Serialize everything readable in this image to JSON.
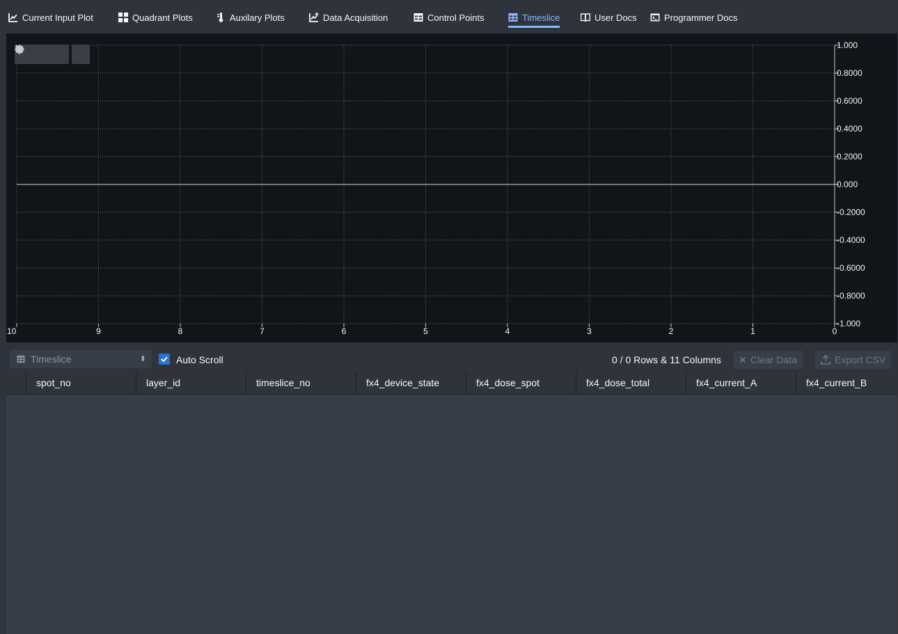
{
  "nav": {
    "tabs": [
      {
        "label": "Current Input Plot",
        "icon": "line-chart-icon"
      },
      {
        "label": "Quadrant Plots",
        "icon": "grid-icon"
      },
      {
        "label": "Auxilary Plots",
        "icon": "thermometer-icon"
      },
      {
        "label": "Data Acquisition",
        "icon": "chart-plus-icon"
      },
      {
        "label": "Control Points",
        "icon": "table-icon"
      },
      {
        "label": "Timeslice",
        "icon": "table-icon",
        "active": true
      },
      {
        "label": "User Docs",
        "icon": "book-icon"
      },
      {
        "label": "Programmer Docs",
        "icon": "console-icon"
      }
    ],
    "active_color": "#8abbff"
  },
  "plot": {
    "toolbar": [
      "gear-icon",
      "close-icon",
      "pause-icon",
      "target-icon"
    ],
    "y_ticks": [
      "1.000",
      "0.8000",
      "0.6000",
      "0.4000",
      "0.2000",
      "0.000",
      "-0.2000",
      "-0.4000",
      "-0.6000",
      "-0.8000",
      "-1.000"
    ],
    "x_ticks": [
      "10",
      "9",
      "8",
      "7",
      "6",
      "5",
      "4",
      "3",
      "2",
      "1",
      "0"
    ],
    "ylim": [
      -1,
      1
    ],
    "xlim": [
      10,
      0
    ],
    "grid": true,
    "series_value": 0
  },
  "controls": {
    "select_value": "Timeslice",
    "auto_scroll_label": "Auto Scroll",
    "auto_scroll_checked": true,
    "row_count": "0 / 0 Rows & 11 Columns",
    "clear_label": "Clear Data",
    "export_label": "Export CSV"
  },
  "table": {
    "columns": [
      "spot_no",
      "layer_id",
      "timeslice_no",
      "fx4_device_state",
      "fx4_dose_spot",
      "fx4_dose_total",
      "fx4_current_A",
      "fx4_current_B"
    ]
  },
  "colors": {
    "background": "#2f343c",
    "plot_background": "#111418",
    "table_background": "#383e47",
    "accent": "#2d72d2"
  }
}
